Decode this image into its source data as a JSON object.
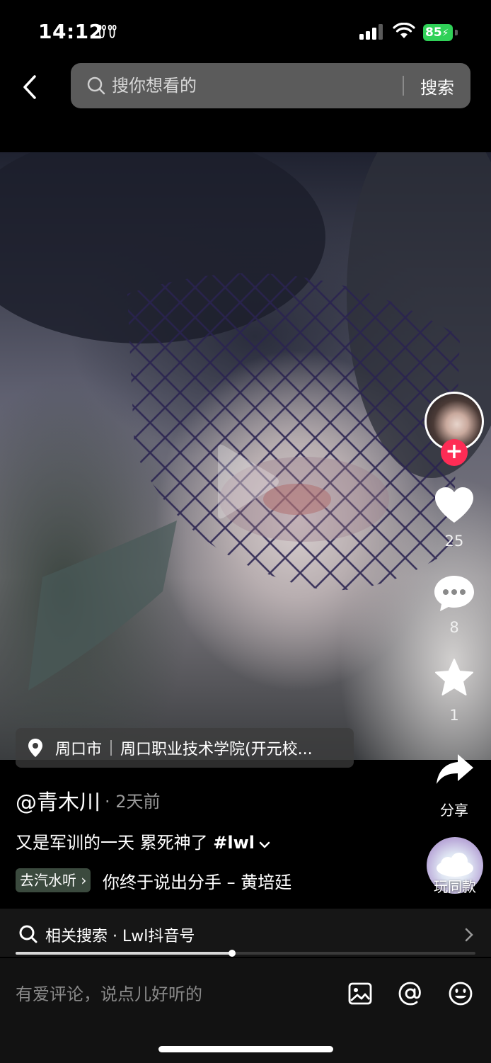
{
  "status_bar": {
    "time": "14:12",
    "extra_glyph": "ꀎꀎ",
    "battery": "85"
  },
  "top_bar": {
    "back_icon": "chevron-left-icon",
    "search_placeholder": "搜你想看的",
    "search_button": "搜索"
  },
  "location": {
    "city": "周口市",
    "place": "周口职业技术学院(开元校..."
  },
  "actions": {
    "likes": "25",
    "comments": "8",
    "favorites": "1",
    "share_label": "分享",
    "music_disc_label": "玩同款",
    "like_color": "#ffffff",
    "follow_color": "#fe2c55"
  },
  "post": {
    "author": "@青木川",
    "time": "· 2天前",
    "caption": "又是军训的一天 累死神了 ",
    "hashtag": "#lwl",
    "music_chip": "去汽水听",
    "music_title": "你终于说出分手 – 黄培廷"
  },
  "related": {
    "text": "相关搜索 · Lwl抖音号"
  },
  "progress": {
    "percent": 47
  },
  "comment": {
    "placeholder": "有爱评论，说点儿好听的"
  }
}
